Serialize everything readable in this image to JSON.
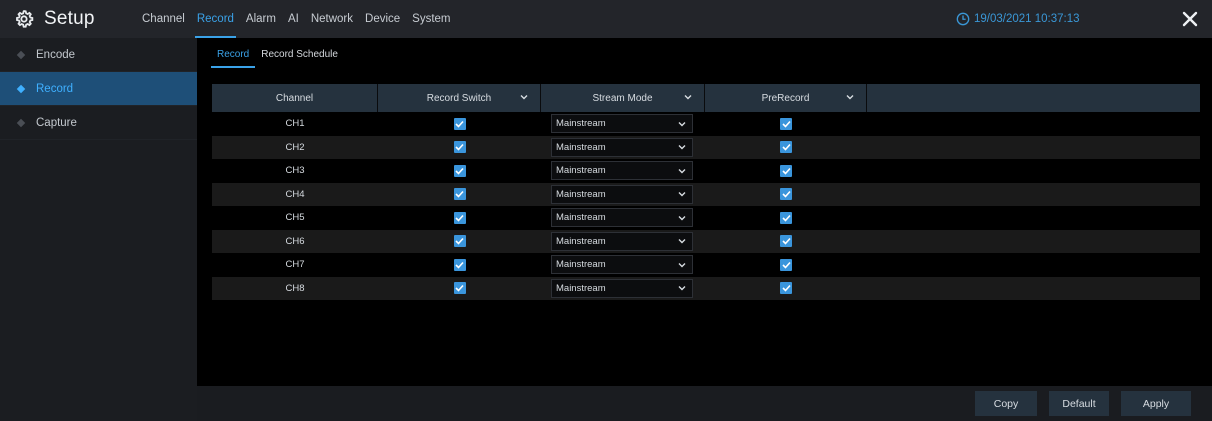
{
  "app": {
    "title": "Setup"
  },
  "topnav": [
    {
      "label": "Channel",
      "active": false
    },
    {
      "label": "Record",
      "active": true
    },
    {
      "label": "Alarm",
      "active": false
    },
    {
      "label": "AI",
      "active": false
    },
    {
      "label": "Network",
      "active": false
    },
    {
      "label": "Device",
      "active": false
    },
    {
      "label": "System",
      "active": false
    }
  ],
  "clock": {
    "datetime": "19/03/2021 10:37:13"
  },
  "sidebar": {
    "items": [
      {
        "label": "Encode",
        "active": false
      },
      {
        "label": "Record",
        "active": true
      },
      {
        "label": "Capture",
        "active": false
      }
    ]
  },
  "subtabs": [
    {
      "label": "Record",
      "active": true
    },
    {
      "label": "Record Schedule",
      "active": false
    }
  ],
  "table": {
    "headers": {
      "channel": "Channel",
      "record_switch": "Record Switch",
      "stream_mode": "Stream Mode",
      "prerecord": "PreRecord"
    },
    "rows": [
      {
        "channel": "CH1",
        "record_switch": true,
        "stream_mode": "Mainstream",
        "prerecord": true
      },
      {
        "channel": "CH2",
        "record_switch": true,
        "stream_mode": "Mainstream",
        "prerecord": true
      },
      {
        "channel": "CH3",
        "record_switch": true,
        "stream_mode": "Mainstream",
        "prerecord": true
      },
      {
        "channel": "CH4",
        "record_switch": true,
        "stream_mode": "Mainstream",
        "prerecord": true
      },
      {
        "channel": "CH5",
        "record_switch": true,
        "stream_mode": "Mainstream",
        "prerecord": true
      },
      {
        "channel": "CH6",
        "record_switch": true,
        "stream_mode": "Mainstream",
        "prerecord": true
      },
      {
        "channel": "CH7",
        "record_switch": true,
        "stream_mode": "Mainstream",
        "prerecord": true
      },
      {
        "channel": "CH8",
        "record_switch": true,
        "stream_mode": "Mainstream",
        "prerecord": true
      }
    ]
  },
  "buttons": {
    "copy": "Copy",
    "default": "Default",
    "apply": "Apply"
  },
  "colors": {
    "accent": "#3aa2e8",
    "checkbox": "#3a95dc",
    "header_bg": "#25323e",
    "sidebar_active": "#1e4f78"
  },
  "icons": {
    "brand": "gear-icon",
    "clock": "clock-icon",
    "close": "close-icon",
    "dropdown": "chevron-down-icon",
    "checkbox": "checkmark-icon",
    "side_bullet": "diamond-icon"
  }
}
